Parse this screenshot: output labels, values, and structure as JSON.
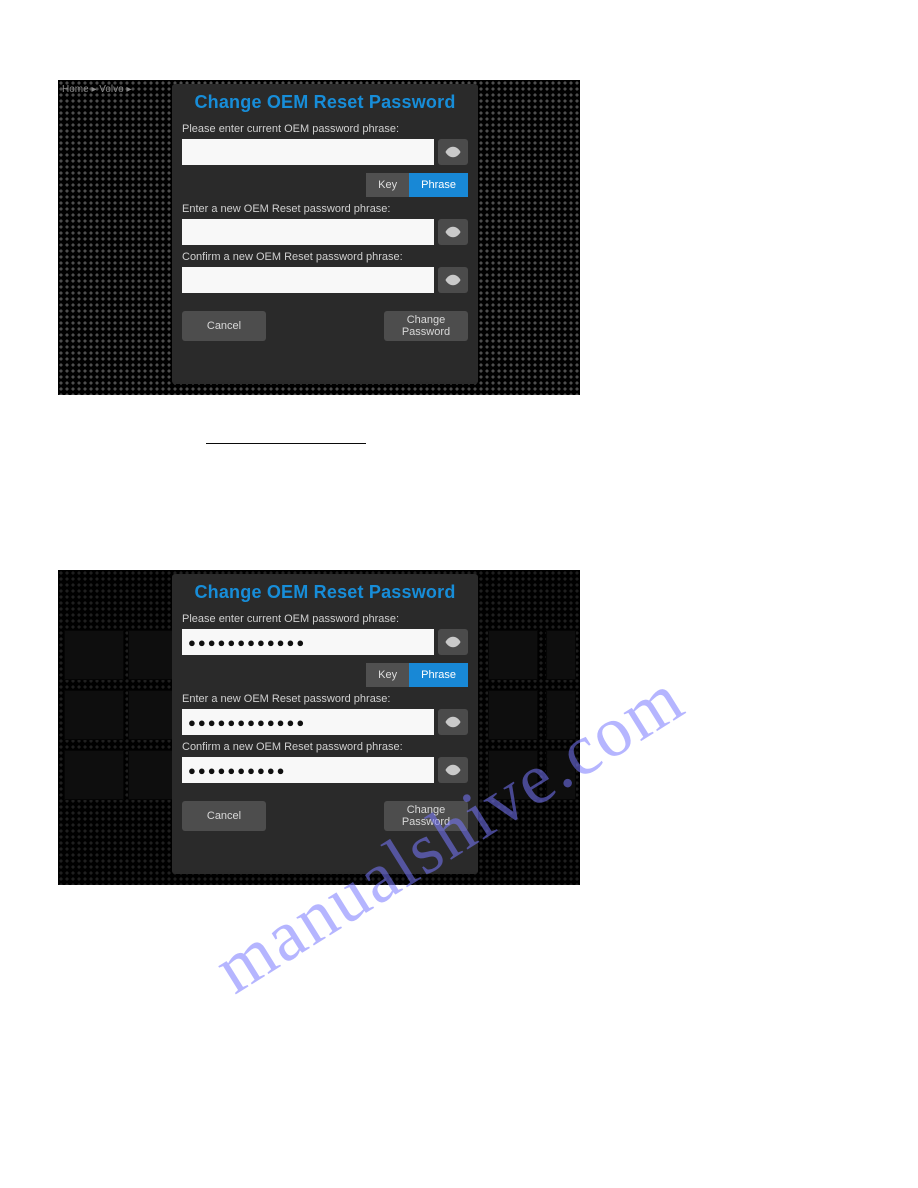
{
  "watermark": "manualshive.com",
  "dialog": {
    "title": "Change OEM Reset Password",
    "label_current": "Please enter current OEM password phrase:",
    "label_new": "Enter a new OEM Reset password phrase:",
    "label_confirm": "Confirm a new OEM Reset password phrase:",
    "seg_key": "Key",
    "seg_phrase": "Phrase",
    "btn_cancel": "Cancel",
    "btn_change": "Change\nPassword"
  },
  "panel1": {
    "crumbs": "Home ▸ Volvo ▸",
    "current_value": "",
    "new_value": "",
    "confirm_value": ""
  },
  "panel2": {
    "current_value": "●●●●●●●●●●●●",
    "new_value": "●●●●●●●●●●●●",
    "confirm_value": "●●●●●●●●●●"
  }
}
